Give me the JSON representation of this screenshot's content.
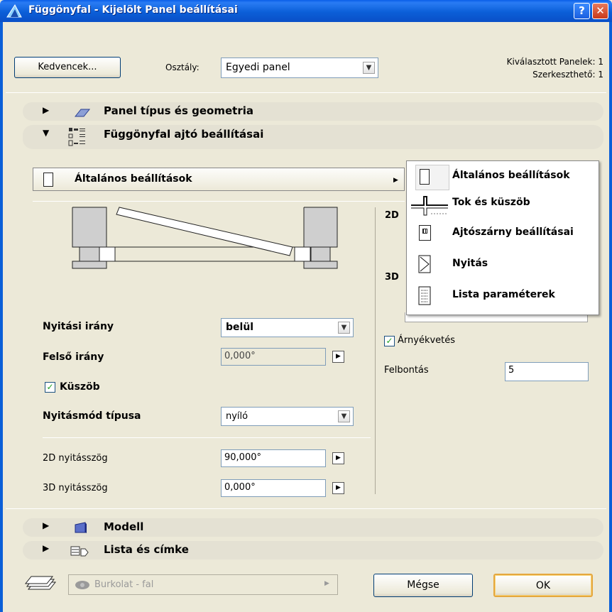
{
  "window": {
    "title": "Függönyfal - Kijelölt Panel beállításai",
    "help": "?",
    "close": "✕"
  },
  "top": {
    "favorites_label": "Kedvencek...",
    "class_label": "Osztály:",
    "class_value": "Egyedi panel",
    "selected_panels": "Kiválasztott Panelek: 1",
    "editable": "Szerkeszthető: 1"
  },
  "sections": {
    "panel_type": "Panel típus és geometria",
    "door_settings": "Függönyfal ajtó beállításai",
    "model": "Modell",
    "list_label": "Lista és címke"
  },
  "page_selector": {
    "value": "Általános beállítások"
  },
  "popup_menu": {
    "items": [
      {
        "label": "Általános beállítások",
        "icon": "door-panel-icon"
      },
      {
        "label": "Tok és küszöb",
        "icon": "frame-threshold-icon"
      },
      {
        "label": "Ajtószárny beállításai",
        "icon": "door-leaf-icon"
      },
      {
        "label": "Nyitás",
        "icon": "opening-icon"
      },
      {
        "label": "Lista paraméterek",
        "icon": "list-params-icon"
      }
    ]
  },
  "left_form": {
    "opening_dir_label": "Nyitási irány",
    "opening_dir_value": "belül",
    "top_dir_label": "Felső irány",
    "top_dir_value": "0,000°",
    "threshold_label": "Küszöb",
    "threshold_checked": true,
    "opening_type_label": "Nyitásmód típusa",
    "opening_type_value": "nyíló",
    "angle_2d_label": "2D nyitásszög",
    "angle_2d_value": "90,000°",
    "angle_3d_label": "3D nyitásszög",
    "angle_3d_value": "0,000°"
  },
  "right_form": {
    "label_2d": "2D",
    "label_3d": "3D",
    "shadow_label": "Árnyékvetés",
    "shadow_checked": true,
    "resolution_label": "Felbontás",
    "resolution_value": "5"
  },
  "bottom": {
    "layer_value": "Burkolat - fal",
    "cancel_label": "Mégse",
    "ok_label": "OK"
  }
}
